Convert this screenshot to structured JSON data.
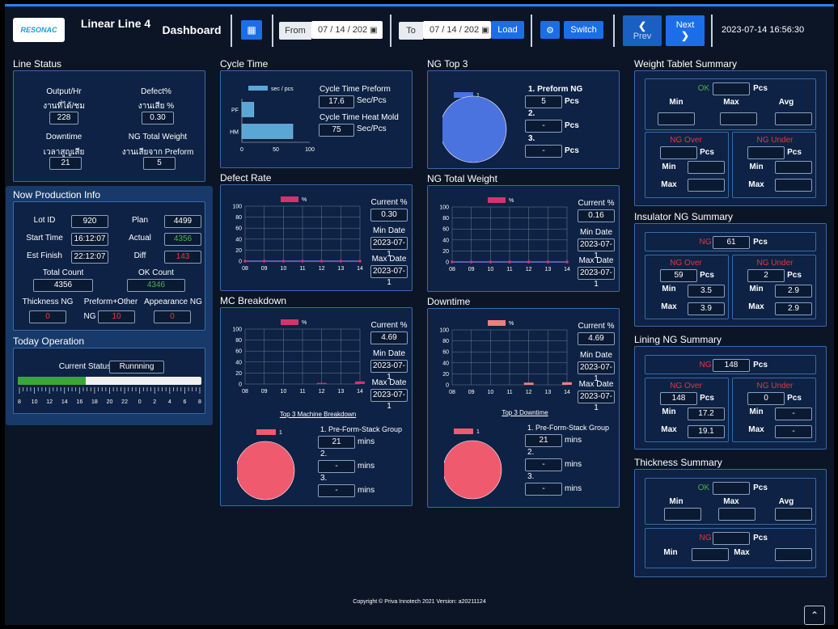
{
  "header": {
    "logo": "RESONAC",
    "line_name": "Linear Line 4",
    "page_title": "Dashboard",
    "from_label": "From",
    "from_date": "07 / 14 / 202",
    "to_label": "To",
    "to_date": "07 / 14 / 202",
    "load_label": "Load",
    "switch_label": "Switch",
    "prev_label": "Prev",
    "next_label": "Next",
    "datetime": "2023-07-14 16:56:30"
  },
  "line_status": {
    "title": "Line Status",
    "output_label": "Output/Hr",
    "output_sub": "งานที่ได้/ชม",
    "output_value": "228",
    "defect_label": "Defect%",
    "defect_sub": "งานเสีย %",
    "defect_value": "0.30",
    "downtime_label": "Downtime",
    "downtime_sub": "เวลาสูญเสีย",
    "downtime_value": "21",
    "ngw_label": "NG Total Weight",
    "ngw_sub": "งานเสียจาก Preform",
    "ngw_value": "5"
  },
  "production": {
    "title": "Now Production Info",
    "lot_label": "Lot ID",
    "lot_value": "920",
    "plan_label": "Plan",
    "plan_value": "4499",
    "start_label": "Start Time",
    "start_value": "16:12:07",
    "actual_label": "Actual",
    "actual_value": "4356",
    "est_label": "Est Finish",
    "est_value": "22:12:07",
    "diff_label": "Diff",
    "diff_value": "143",
    "total_label": "Total Count",
    "total_value": "4356",
    "ok_label": "OK Count",
    "ok_value": "4346",
    "thick_label": "Thickness NG",
    "thick_value": "0",
    "preform_label": "Preform+Other",
    "preform_sub": "NG",
    "preform_value": "10",
    "appear_label": "Appearance NG",
    "appear_value": "0"
  },
  "operation": {
    "title": "Today Operation",
    "status_label": "Current Status",
    "status_value": "Runnning",
    "progress": 0.37,
    "ticks": [
      "8",
      "10",
      "12",
      "14",
      "16",
      "18",
      "20",
      "22",
      "0",
      "2",
      "4",
      "6",
      "8"
    ]
  },
  "cycle": {
    "title": "Cycle Time",
    "preform_label": "Cycle Time Preform",
    "preform_value": "17.6",
    "preform_unit": "Sec/Pcs",
    "heat_label": "Cycle Time Heat Mold",
    "heat_value": "75",
    "heat_unit": "Sec/Pcs"
  },
  "defect": {
    "title": "Defect Rate",
    "current_label": "Current %",
    "current_value": "0.30",
    "min_label": "Min Date",
    "min_value": "2023-07-1",
    "max_label": "Max Date",
    "max_value": "2023-07-1"
  },
  "mc": {
    "title": "MC Breakdown",
    "current_label": "Current %",
    "current_value": "4.69",
    "min_label": "Min Date",
    "min_value": "2023-07-1",
    "max_label": "Max Date",
    "max_value": "2023-07-1",
    "top3_link": "Top 3 Machine Breakdown",
    "item1_label": "1. Pre-Form-Stack Group",
    "item1_value": "21",
    "item1_unit": "mins",
    "item2_label": "2.",
    "item2_value": "-",
    "item2_unit": "mins",
    "item3_label": "3.",
    "item3_value": "-",
    "item3_unit": "mins"
  },
  "ngtop": {
    "title": "NG Top 3",
    "item1_label": "1. Preform NG",
    "item1_value": "5",
    "item1_unit": "Pcs",
    "item2_label": "2.",
    "item2_value": "-",
    "item2_unit": "Pcs",
    "item3_label": "3.",
    "item3_value": "-",
    "item3_unit": "Pcs"
  },
  "ngweight": {
    "title": "NG Total Weight",
    "current_label": "Current %",
    "current_value": "0.16",
    "min_label": "Min Date",
    "min_value": "2023-07-1",
    "max_label": "Max Date",
    "max_value": "2023-07-1"
  },
  "downtime": {
    "title": "Downtime",
    "current_label": "Current %",
    "current_value": "4.69",
    "min_label": "Min Date",
    "min_value": "2023-07-1",
    "max_label": "Max Date",
    "max_value": "2023-07-1",
    "top3_link": "Top 3 Downtime",
    "item1_label": "1. Pre-Form-Stack Group",
    "item1_value": "21",
    "item1_unit": "mins",
    "item2_label": "2.",
    "item2_value": "-",
    "item2_unit": "mins",
    "item3_label": "3.",
    "item3_value": "-",
    "item3_unit": "mins"
  },
  "weight_tablet": {
    "title": "Weight Tablet Summary",
    "ok": "OK",
    "ok_value": "",
    "pcs": "Pcs",
    "min": "Min",
    "max": "Max",
    "avg": "Avg",
    "ng_over": "NG Over",
    "ng_under": "NG Under",
    "over_value": "",
    "under_value": "",
    "over_min": "",
    "over_max": "",
    "under_min": "",
    "under_max": ""
  },
  "insulator": {
    "title": "Insulator NG Summary",
    "ng": "NG",
    "ng_value": "61",
    "pcs": "Pcs",
    "ng_over": "NG Over",
    "ng_under": "NG Under",
    "over_value": "59",
    "under_value": "2",
    "min": "Min",
    "max": "Max",
    "over_min": "3.5",
    "over_max": "3.9",
    "under_min": "2.9",
    "under_max": "2.9"
  },
  "lining": {
    "title": "Lining NG Summary",
    "ng": "NG",
    "ng_value": "148",
    "pcs": "Pcs",
    "ng_over": "NG Over",
    "ng_under": "NG Under",
    "over_value": "148",
    "under_value": "0",
    "min": "Min",
    "max": "Max",
    "over_min": "17.2",
    "over_max": "19.1",
    "under_min": "-",
    "under_max": "-"
  },
  "thickness": {
    "title": "Thickness Summary",
    "ok": "OK",
    "pcs": "Pcs",
    "min": "Min",
    "max": "Max",
    "avg": "Avg",
    "ng": "NG"
  },
  "footer": {
    "copyright": "Copyright © Priva Innotech 2021 Version: a20211124"
  },
  "chart_data": [
    {
      "type": "bar",
      "id": "cycle",
      "orientation": "horizontal",
      "categories": [
        "PF",
        "HM"
      ],
      "series": [
        {
          "name": "sec / pcs",
          "values": [
            17.6,
            75
          ]
        }
      ],
      "xlim": [
        0,
        100
      ],
      "xticks": [
        "0",
        "50",
        "100"
      ],
      "color": "#5aa7d6"
    },
    {
      "type": "line",
      "id": "defect",
      "x": [
        "08",
        "09",
        "10",
        "11",
        "12",
        "13",
        "14"
      ],
      "series": [
        {
          "name": "%",
          "values": [
            0,
            0,
            0,
            0,
            0,
            0,
            0
          ]
        }
      ],
      "ylim": [
        0,
        100
      ],
      "yticks": [
        "0",
        "20",
        "40",
        "60",
        "80",
        "100"
      ],
      "color": "#d6336c"
    },
    {
      "type": "bar",
      "id": "mc",
      "x": [
        "08",
        "09",
        "10",
        "11",
        "12",
        "13",
        "14"
      ],
      "series": [
        {
          "name": "%",
          "values": [
            0,
            0,
            0,
            0,
            2,
            0,
            4.69
          ]
        }
      ],
      "ylim": [
        0,
        100
      ],
      "yticks": [
        "0",
        "20",
        "40",
        "60",
        "80",
        "100"
      ],
      "color": "#d6336c"
    },
    {
      "type": "pie",
      "id": "mc_pie",
      "labels": [
        "1"
      ],
      "values": [
        100
      ],
      "color": "#f05a6e"
    },
    {
      "type": "pie",
      "id": "ngtop_pie",
      "labels": [
        "1"
      ],
      "values": [
        100
      ],
      "color": "#4a73e0"
    },
    {
      "type": "line",
      "id": "ngweight",
      "x": [
        "08",
        "09",
        "10",
        "11",
        "12",
        "13",
        "14"
      ],
      "series": [
        {
          "name": "%",
          "values": [
            0,
            0,
            0,
            0,
            0,
            0,
            0
          ]
        }
      ],
      "ylim": [
        0,
        100
      ],
      "yticks": [
        "0",
        "20",
        "40",
        "60",
        "80",
        "100"
      ],
      "color": "#d6336c"
    },
    {
      "type": "bar",
      "id": "downtime",
      "x": [
        "08",
        "09",
        "10",
        "11",
        "12",
        "13",
        "14"
      ],
      "series": [
        {
          "name": "%",
          "values": [
            0,
            0,
            0,
            0,
            4,
            0,
            4.69
          ]
        }
      ],
      "ylim": [
        0,
        100
      ],
      "yticks": [
        "0",
        "20",
        "40",
        "60",
        "80",
        "100"
      ],
      "color": "#f07f7f"
    },
    {
      "type": "pie",
      "id": "down_pie",
      "labels": [
        "1"
      ],
      "values": [
        100
      ],
      "color": "#f05a6e"
    }
  ]
}
